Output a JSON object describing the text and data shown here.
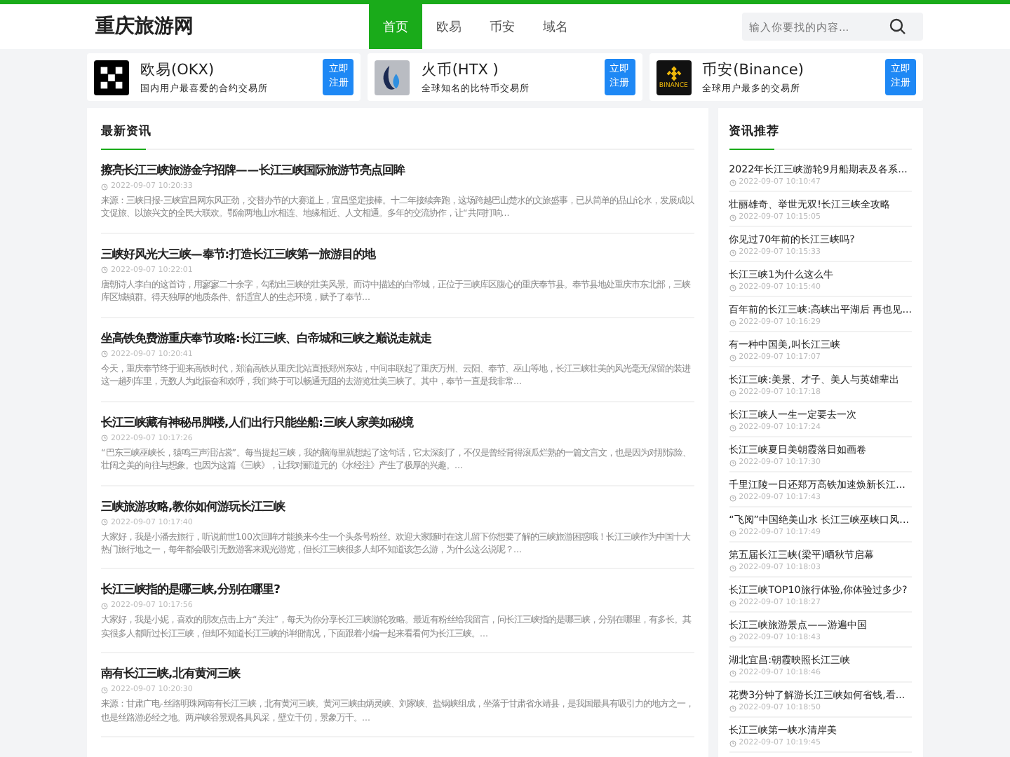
{
  "site": {
    "logo": "重庆旅游网"
  },
  "nav": [
    {
      "label": "首页",
      "selected": true
    },
    {
      "label": "欧易",
      "selected": false
    },
    {
      "label": "币安",
      "selected": false
    },
    {
      "label": "域名",
      "selected": false
    }
  ],
  "search": {
    "placeholder": "输入你要找的内容..."
  },
  "exchanges": [
    {
      "kind": "okx",
      "name": "欧易(OKX)",
      "desc": "国内用户最喜爱的合约交易所",
      "button": "立即注册"
    },
    {
      "kind": "htx",
      "name": "火币(HTX )",
      "desc": "全球知名的比特币交易所",
      "button": "立即注册"
    },
    {
      "kind": "binance",
      "name": "币安(Binance)",
      "desc": "全球用户最多的交易所",
      "logo_text": "BINANCE",
      "button": "立即注册"
    }
  ],
  "news": {
    "title": "最新资讯",
    "articles": [
      {
        "title": "擦亮长江三峡旅游金字招牌——长江三峡国际旅游节亮点回眸",
        "time": "2022-09-07 10:20:33",
        "summary": "来源：三峡日报-三峡宜昌网东风正劲，交替办节的大赛道上，宜昌坚定接棒。十二年接续奔跑，这场跨越巴山楚水的文旅盛事，已从简单的品山论水，发展成以文促旅、以旅兴文的全民大联欢。鄂渝两地山水相连、地缘相近、人文相通。多年的交流协作，让“共同打响..."
      },
      {
        "title": "三峡好风光大三峡—奉节:打造长江三峡第一旅游目的地",
        "time": "2022-09-07 10:22:01",
        "summary": "唐朝诗人李白的这首诗，用寥寥二十余字，勾勒出三峡的壮美风景。而诗中描述的白帝城，正位于三峡库区腹心的重庆奉节县。奉节县地处重庆市东北部，三峡库区城镇群。得天独厚的地质条件、舒适宜人的生态环境，赋予了奉节..."
      },
      {
        "title": "坐高铁免费游重庆奉节攻略:长江三峡、白帝城和三峡之巅说走就走",
        "time": "2022-09-07 10:20:41",
        "summary": "今天，重庆奉节终于迎来高铁时代，郑渝高铁从重庆北站直抵郑州东站，中间串联起了重庆万州、云阳、奉节、巫山等地，长江三峡壮美的风光毫无保留的装进这一趟列车里，无数人为此振奋和欢呼，我们终于可以畅通无阻的去游览壮美三峡了。其中，奉节一直是我非常..."
      },
      {
        "title": "长江三峡藏有神秘吊脚楼,人们出行只能坐船:三峡人家美如秘境",
        "time": "2022-09-07 10:17:26",
        "summary": "“巴东三峡巫峡长，猿鸣三声泪沾裳”。每当提起三峡，我的脑海里就想起了这句话，它太深刻了，不仅是曾经背得滚瓜烂熟的一篇文言文，也是因为对那惊险、壮阔之美的向往与想象。也因为这篇《三峡》，让我对郦道元的《水经注》产生了极厚的兴趣。..."
      },
      {
        "title": "三峡旅游攻略,教你如何游玩长江三峡",
        "time": "2022-09-07 10:17:40",
        "summary": "大家好，我是小潘去旅行，听说前世100次回眸才能换来今生一个头条号粉丝。欢迎大家随时在这儿留下你想要了解的三峡旅游困惑哦！长江三峡作为中国十大热门旅行地之一，每年都会吸引无数游客来观光游览，但长江三峡很多人却不知道该怎么游，为什么这么说呢？..."
      },
      {
        "title": "长江三峡指的是哪三峡,分别在哪里?",
        "time": "2022-09-07 10:17:56",
        "summary": "大家好，我是小妮，喜欢的朋友点击上方“关注”，每天为你分享长江三峡游轮攻略。最近有粉丝给我留言，问长江三峡指的是哪三峡，分别在哪里，有多长。其实很多人都听过长江三峡，但却不知道长江三峡的详细情况，下面跟着小编一起来看看何为长江三峡。..."
      },
      {
        "title": "南有长江三峡,北有黄河三峡",
        "time": "2022-09-07 10:20:30",
        "summary": "来源：甘肃广电-丝路明珠网南有长江三峡，北有黄河三峡。黄河三峡由炳灵峡、刘家峡、盐锅峡组成，坐落于甘肃省永靖县，是我国最具有吸引力的地方之一，也是丝路游必经之地。两岸峡谷景观各具风采，壁立千仞，景象万千。..."
      }
    ]
  },
  "recommend": {
    "title": "资讯推荐",
    "items": [
      {
        "title": "2022年长江三峡游轮9月船期表及各系...",
        "time": "2022-09-07 10:10:47"
      },
      {
        "title": "壮丽雄奇、举世无双!长江三峡全攻略",
        "time": "2022-09-07 10:15:05"
      },
      {
        "title": "你见过70年前的长江三峡吗?",
        "time": "2022-09-07 10:15:33"
      },
      {
        "title": "长江三峡1为什么这么牛",
        "time": "2022-09-07 10:15:40"
      },
      {
        "title": "百年前的长江三峡:高峡出平湖后 再也见...",
        "time": "2022-09-07 10:16:29"
      },
      {
        "title": "有一种中国美,叫长江三峡",
        "time": "2022-09-07 10:17:07"
      },
      {
        "title": "长江三峡:美景、才子、美人与英雄辈出",
        "time": "2022-09-07 10:17:18"
      },
      {
        "title": "长江三峡人一生一定要去一次",
        "time": "2022-09-07 10:17:24"
      },
      {
        "title": "长江三峡夏日美朝霞落日如画卷",
        "time": "2022-09-07 10:17:30"
      },
      {
        "title": "千里江陵一日还郑万高铁加速焕新长江...",
        "time": "2022-09-07 10:17:43"
      },
      {
        "title": "“飞阅”中国绝美山水 长江三峡巫峡口风...",
        "time": "2022-09-07 10:17:49"
      },
      {
        "title": "第五届长江三峡(梁平)晒秋节启幕",
        "time": "2022-09-07 10:18:03"
      },
      {
        "title": "长江三峡TOP10旅行体验,你体验过多少?",
        "time": "2022-09-07 10:18:27"
      },
      {
        "title": "长江三峡旅游景点——游遍中国",
        "time": "2022-09-07 10:18:43"
      },
      {
        "title": "湖北宜昌:朝霞映照长江三峡",
        "time": "2022-09-07 10:18:46"
      },
      {
        "title": "花费3分钟了解游长江三峡如何省钱,看...",
        "time": "2022-09-07 10:18:50"
      },
      {
        "title": "长江三峡第一峡水清岸美",
        "time": "2022-09-07 10:19:45"
      }
    ]
  }
}
